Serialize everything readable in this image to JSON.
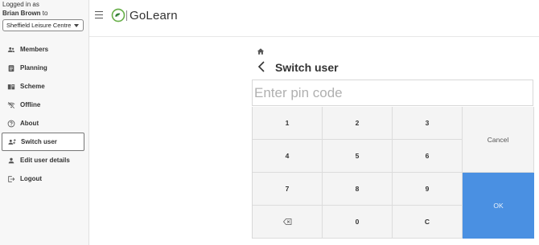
{
  "session": {
    "logged_in_as": "Logged in as",
    "user_name": "Brian Brown",
    "to_text": "to",
    "centre": "Sheffield Leisure Centre"
  },
  "sidebar": {
    "items": [
      {
        "label": "Members",
        "icon": "members-icon"
      },
      {
        "label": "Planning",
        "icon": "clipboard-icon"
      },
      {
        "label": "Scheme",
        "icon": "book-icon"
      },
      {
        "label": "Offline",
        "icon": "wifi-off-icon"
      },
      {
        "label": "About",
        "icon": "help-circle-icon"
      },
      {
        "label": "Switch user",
        "icon": "switch-user-icon",
        "active": true
      },
      {
        "label": "Edit user details",
        "icon": "person-icon"
      },
      {
        "label": "Logout",
        "icon": "logout-icon"
      }
    ]
  },
  "header": {
    "brand": "GoLearn"
  },
  "page": {
    "title": "Switch user",
    "pin_placeholder": "Enter pin code",
    "pin_value": ""
  },
  "keypad": {
    "k1": "1",
    "k2": "2",
    "k3": "3",
    "k4": "4",
    "k5": "5",
    "k6": "6",
    "k7": "7",
    "k8": "8",
    "k9": "9",
    "k0": "0",
    "clear": "C",
    "cancel": "Cancel",
    "ok": "OK"
  },
  "colors": {
    "accent": "#4a90e2",
    "sidebar_bg": "#f7f7f7",
    "key_bg": "#f4f4f4"
  }
}
